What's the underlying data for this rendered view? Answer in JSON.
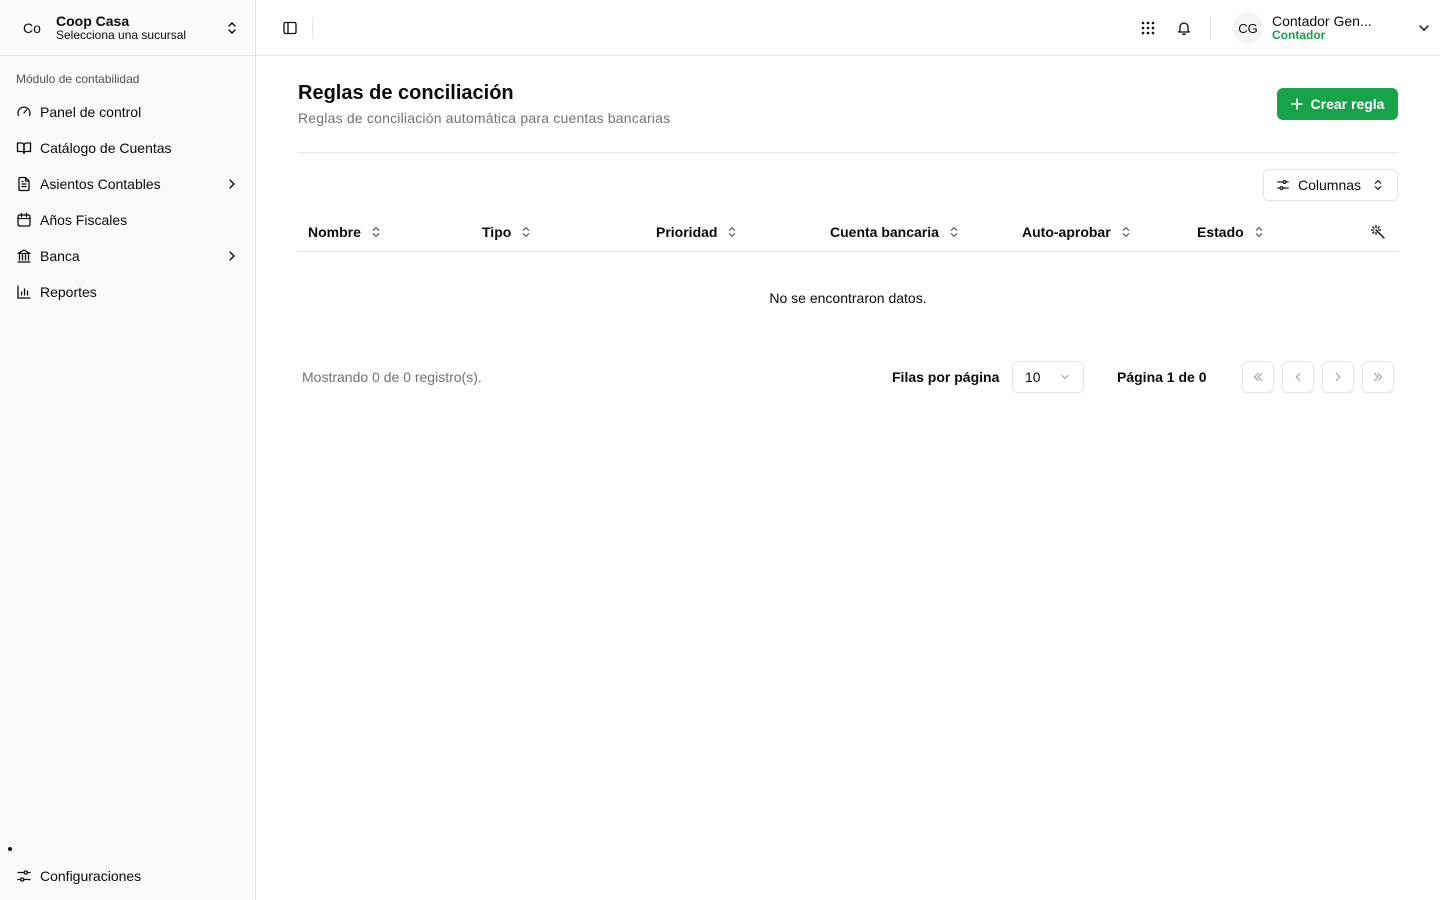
{
  "org": {
    "initials": "Co",
    "name": "Coop Casa",
    "subtitle": "Selecciona una sucursal"
  },
  "sidebar": {
    "group_label": "Módulo de contabilidad",
    "items": [
      {
        "label": "Panel de control",
        "icon": "gauge-icon"
      },
      {
        "label": "Catálogo de Cuentas",
        "icon": "book-open-icon"
      },
      {
        "label": "Asientos Contables",
        "icon": "file-text-icon",
        "has_submenu": true
      },
      {
        "label": "Años Fiscales",
        "icon": "calendar-icon"
      },
      {
        "label": "Banca",
        "icon": "landmark-icon",
        "has_submenu": true
      },
      {
        "label": "Reportes",
        "icon": "bar-chart-icon"
      }
    ],
    "settings_label": "Configuraciones"
  },
  "user": {
    "initials": "CG",
    "name": "Contador Gen...",
    "role": "Contador"
  },
  "page": {
    "title": "Reglas de conciliación",
    "subtitle": "Reglas de conciliación automática para cuentas bancarias",
    "create_label": "Crear regla",
    "columns_label": "Columnas"
  },
  "table": {
    "headers": [
      "Nombre",
      "Tipo",
      "Prioridad",
      "Cuenta bancaria",
      "Auto-aprobar",
      "Estado"
    ],
    "empty_text": "No se encontraron datos."
  },
  "pagination": {
    "showing": "Mostrando 0 de 0 registro(s).",
    "rows_label": "Filas por página",
    "rows_value": "10",
    "page_info": "Página 1 de 0"
  },
  "colors": {
    "accent": "#16a34a",
    "border": "#e5e5e5",
    "muted": "#737373"
  }
}
